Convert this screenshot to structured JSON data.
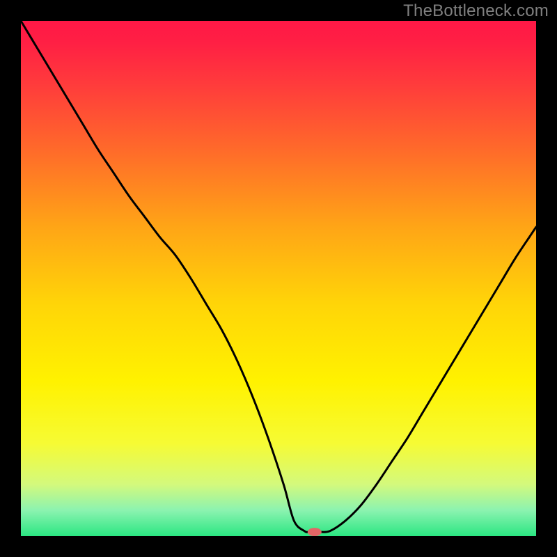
{
  "watermark": "TheBottleneck.com",
  "chart_data": {
    "type": "line",
    "title": "",
    "xlabel": "",
    "ylabel": "",
    "xlim": [
      0,
      100
    ],
    "ylim": [
      0,
      100
    ],
    "background_gradient_stops": [
      {
        "offset": 0.0,
        "color": "#ff1846"
      },
      {
        "offset": 0.04,
        "color": "#ff1f44"
      },
      {
        "offset": 0.12,
        "color": "#ff3a3c"
      },
      {
        "offset": 0.25,
        "color": "#ff6a2a"
      },
      {
        "offset": 0.4,
        "color": "#ffa516"
      },
      {
        "offset": 0.55,
        "color": "#ffd508"
      },
      {
        "offset": 0.7,
        "color": "#fff200"
      },
      {
        "offset": 0.82,
        "color": "#f6fb34"
      },
      {
        "offset": 0.9,
        "color": "#d3f97d"
      },
      {
        "offset": 0.95,
        "color": "#8bf3b0"
      },
      {
        "offset": 1.0,
        "color": "#2be682"
      }
    ],
    "series": [
      {
        "name": "bottleneck-curve",
        "color": "#000000",
        "stroke_width": 3,
        "x": [
          0,
          3,
          6,
          9,
          12,
          15,
          18,
          21,
          24,
          27,
          30,
          33,
          36,
          39,
          42,
          45,
          48,
          51,
          53,
          55,
          56,
          58,
          60,
          63,
          66,
          69,
          72,
          75,
          78,
          81,
          84,
          87,
          90,
          93,
          96,
          99,
          100
        ],
        "y": [
          100,
          95,
          90,
          85,
          80,
          75,
          70.5,
          66,
          62,
          58,
          54.5,
          50,
          45,
          40,
          34,
          27,
          19,
          10,
          3,
          1,
          0.8,
          0.8,
          1,
          3,
          6,
          10,
          14.5,
          19,
          24,
          29,
          34,
          39,
          44,
          49,
          54,
          58.5,
          60
        ]
      }
    ],
    "marker": {
      "name": "optimal-point",
      "x": 57,
      "y": 0.8,
      "color": "#e36666",
      "rx": 10,
      "ry": 6
    }
  }
}
